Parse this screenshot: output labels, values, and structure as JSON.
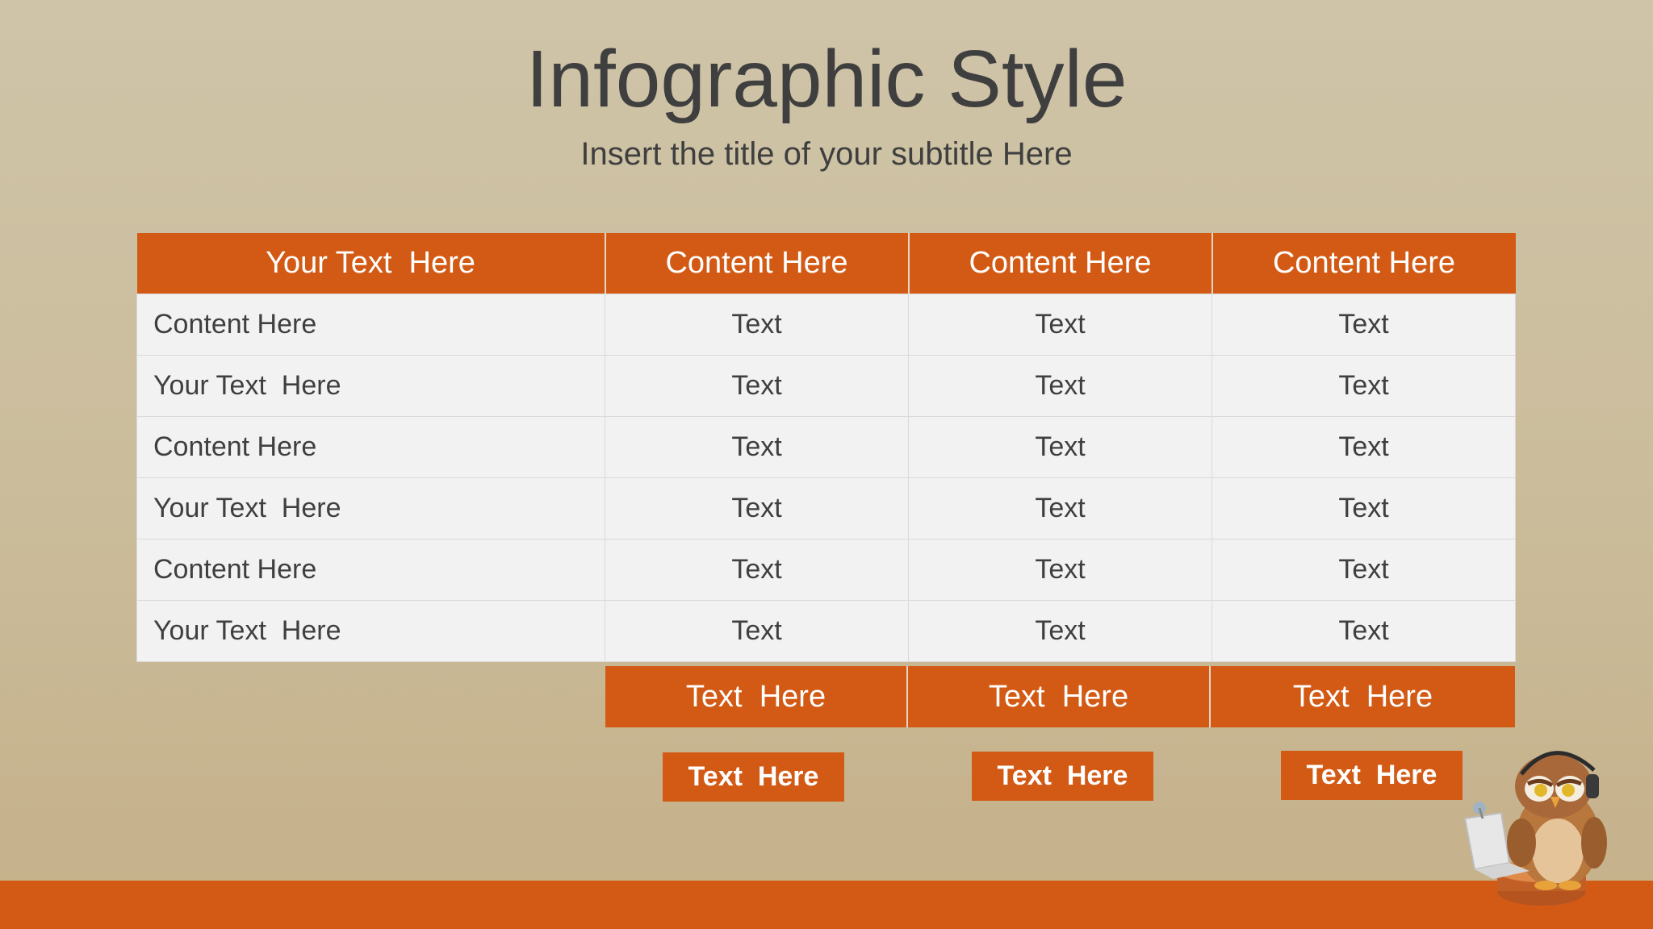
{
  "title": "Infographic Style",
  "subtitle": "Insert the title of your subtitle Here",
  "table": {
    "headers": [
      "Your Text  Here",
      "Content Here",
      "Content Here",
      "Content Here"
    ],
    "rows": [
      [
        "Content Here",
        "Text",
        "Text",
        "Text"
      ],
      [
        "Your Text  Here",
        "Text",
        "Text",
        "Text"
      ],
      [
        "Content Here",
        "Text",
        "Text",
        "Text"
      ],
      [
        "Your Text  Here",
        "Text",
        "Text",
        "Text"
      ],
      [
        "Content Here",
        "Text",
        "Text",
        "Text"
      ],
      [
        "Your Text  Here",
        "Text",
        "Text",
        "Text"
      ]
    ],
    "footer": [
      "Text  Here",
      "Text  Here",
      "Text  Here"
    ]
  },
  "buttons": [
    "Text  Here",
    "Text  Here",
    "Text  Here"
  ],
  "colors": {
    "accent": "#d35a14",
    "text": "#3f3f3f",
    "cell_bg": "#f2f2f2"
  },
  "icons": {
    "mascot": "owl-with-headphones-and-laptop-icon"
  }
}
